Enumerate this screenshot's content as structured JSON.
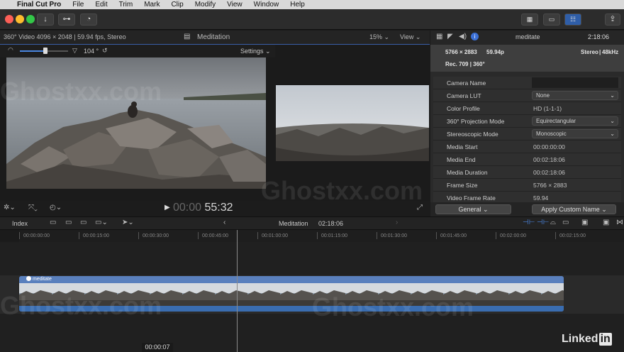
{
  "menubar": {
    "apple": "",
    "app": "Final Cut Pro",
    "items": [
      "File",
      "Edit",
      "Trim",
      "Mark",
      "Clip",
      "Modify",
      "View",
      "Window",
      "Help"
    ]
  },
  "viewer": {
    "info": "360° Video 4096 × 2048 | 59.94 fps, Stereo",
    "title": "Meditation",
    "zoom": "15%",
    "view": "View",
    "angle": "104 °",
    "settings": "Settings",
    "timecode_dim": "00:00",
    "timecode": "55:32"
  },
  "inspector": {
    "clip_name": "meditate",
    "duration": "2:18:06",
    "resolution": "5766 × 2883",
    "fps": "59.94p",
    "audio": "Stereo",
    "rate": "48kHz",
    "color": "Rec. 709 | 360°",
    "rows": [
      {
        "label": "Camera Name",
        "value": "",
        "type": "text"
      },
      {
        "label": "Camera LUT",
        "value": "None",
        "type": "drop"
      },
      {
        "label": "Color Profile",
        "value": "HD (1-1-1)",
        "type": "text"
      },
      {
        "label": "360° Projection Mode",
        "value": "Equirectangular",
        "type": "drop"
      },
      {
        "label": "Stereoscopic Mode",
        "value": "Monoscopic",
        "type": "drop"
      },
      {
        "label": "Media Start",
        "value": "00:00:00:00",
        "type": "text"
      },
      {
        "label": "Media End",
        "value": "00:02:18:06",
        "type": "text"
      },
      {
        "label": "Media Duration",
        "value": "00:02:18:06",
        "type": "text"
      },
      {
        "label": "Frame Size",
        "value": "5766 × 2883",
        "type": "text"
      },
      {
        "label": "Video Frame Rate",
        "value": "59.94",
        "type": "text"
      }
    ],
    "general": "General",
    "apply": "Apply Custom Name"
  },
  "timeline": {
    "index": "Index",
    "name": "Meditation",
    "duration": "02:18:06",
    "clip": "meditate",
    "skimmer_tc": "00:00:07",
    "ruler": [
      "00:00:00:00",
      "00:00:15:00",
      "00:00:30:00",
      "00:00:45:00",
      "00:01:00:00",
      "00:01:15:00",
      "00:01:30:00",
      "00:01:45:00",
      "00:02:00:00",
      "00:02:15:00"
    ]
  },
  "watermark": "Ghostxx.com",
  "brand": {
    "linked": "Linked",
    "in": "in"
  },
  "colors": {
    "accent": "#3a5ea8",
    "clip": "#5a80bd",
    "red": "#fc5f57",
    "yellow": "#fdbc2e",
    "green": "#33c748"
  }
}
